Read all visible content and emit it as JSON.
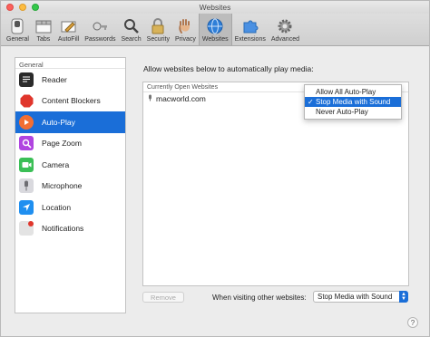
{
  "window": {
    "title": "Websites"
  },
  "toolbar": {
    "items": [
      {
        "label": "General",
        "icon": "switch-icon"
      },
      {
        "label": "Tabs",
        "icon": "tabs-icon"
      },
      {
        "label": "AutoFill",
        "icon": "pencil-icon"
      },
      {
        "label": "Passwords",
        "icon": "key-icon"
      },
      {
        "label": "Search",
        "icon": "magnifier-icon"
      },
      {
        "label": "Security",
        "icon": "lock-icon"
      },
      {
        "label": "Privacy",
        "icon": "hand-icon"
      },
      {
        "label": "Websites",
        "icon": "globe-icon",
        "selected": true
      },
      {
        "label": "Extensions",
        "icon": "puzzle-icon"
      },
      {
        "label": "Advanced",
        "icon": "gear-icon"
      }
    ]
  },
  "sidebar": {
    "header": "General",
    "items": [
      {
        "label": "Reader",
        "icon": "reader-icon",
        "color": "#2b2b2b"
      },
      {
        "label": "Content Blockers",
        "icon": "stop-icon",
        "color": "#e0362c"
      },
      {
        "label": "Auto-Play",
        "icon": "play-icon",
        "color": "#f26e33",
        "selected": true
      },
      {
        "label": "Page Zoom",
        "icon": "zoom-icon",
        "color": "#b044e0"
      },
      {
        "label": "Camera",
        "icon": "camera-icon",
        "color": "#3bbf56"
      },
      {
        "label": "Microphone",
        "icon": "microphone-icon",
        "color": "#8e8e93"
      },
      {
        "label": "Location",
        "icon": "location-icon",
        "color": "#1f8ff0"
      },
      {
        "label": "Notifications",
        "icon": "notifications-icon",
        "color": "#d6d6d6"
      }
    ]
  },
  "main": {
    "heading": "Allow websites below to automatically play media:",
    "list_header": "Currently Open Websites",
    "rows": [
      {
        "site": "macworld.com"
      }
    ],
    "popup": {
      "options": [
        "Allow All Auto-Play",
        "Stop Media with Sound",
        "Never Auto-Play"
      ],
      "selected": "Stop Media with Sound",
      "check_glyph": "✓"
    },
    "remove_label": "Remove",
    "other_label": "When visiting other websites:",
    "other_value": "Stop Media with Sound"
  },
  "help_label": "?"
}
